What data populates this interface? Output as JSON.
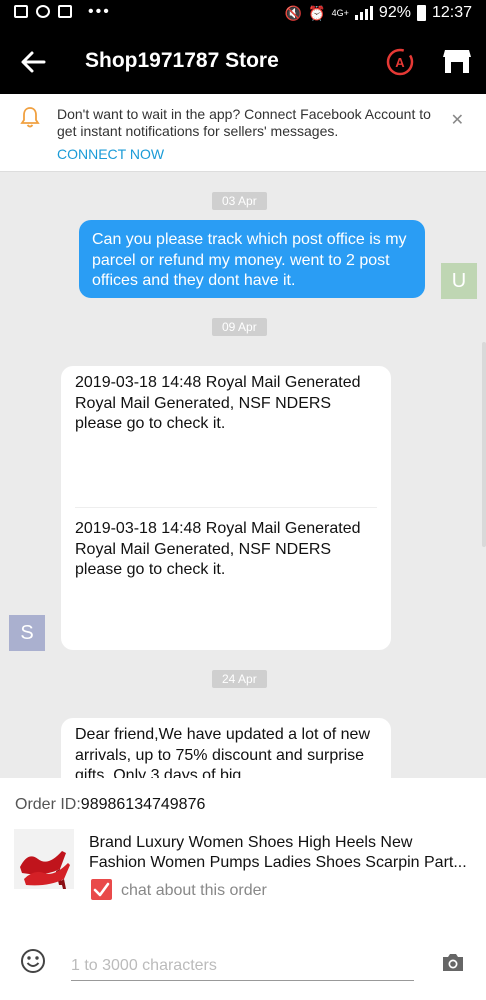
{
  "status_bar": {
    "battery": "92%",
    "time": "12:37",
    "network": "4G+"
  },
  "header": {
    "title": "Shop1971787 Store"
  },
  "banner": {
    "text": "Don't want to wait in the app? Connect Facebook Account to get instant notifications for sellers' messages.",
    "link": "CONNECT NOW"
  },
  "chat": {
    "dates": [
      "03 Apr",
      "09 Apr",
      "24 Apr"
    ],
    "messages": [
      {
        "sender": "U",
        "text": "Can you please track which post office is my parcel or refund my money. went to 2 post offices and they dont have it."
      },
      {
        "sender": "S",
        "part1": "2019-03-18 14:48 Royal Mail Generated Royal Mail Generated, NSF NDERS\nplease go to check it.",
        "part2": "2019-03-18 14:48 Royal Mail Generated Royal Mail Generated, NSF NDERS\nplease go to check it."
      },
      {
        "text": "Dear friend,We have updated a lot of new arrivals, up to 75% discount and surprise gifts. Only 3 days of big"
      }
    ]
  },
  "order": {
    "label": "Order ID:",
    "id": "98986134749876",
    "product_title": "Brand Luxury Women Shoes High Heels New Fashion Women Pumps Ladies Shoes Scarpin Part...",
    "product_line1": "Brand Luxury Women Shoes High Heels New",
    "product_line2": "Fashion Women Pumps Ladies Shoes Scarpin Part...",
    "checkbox_label": "chat about this order"
  },
  "composer": {
    "placeholder": "1 to 3000 characters"
  },
  "colors": {
    "accent": "#1a9bd7",
    "bubble_out": "#2a9df4",
    "checkbox": "#e94a4a"
  }
}
